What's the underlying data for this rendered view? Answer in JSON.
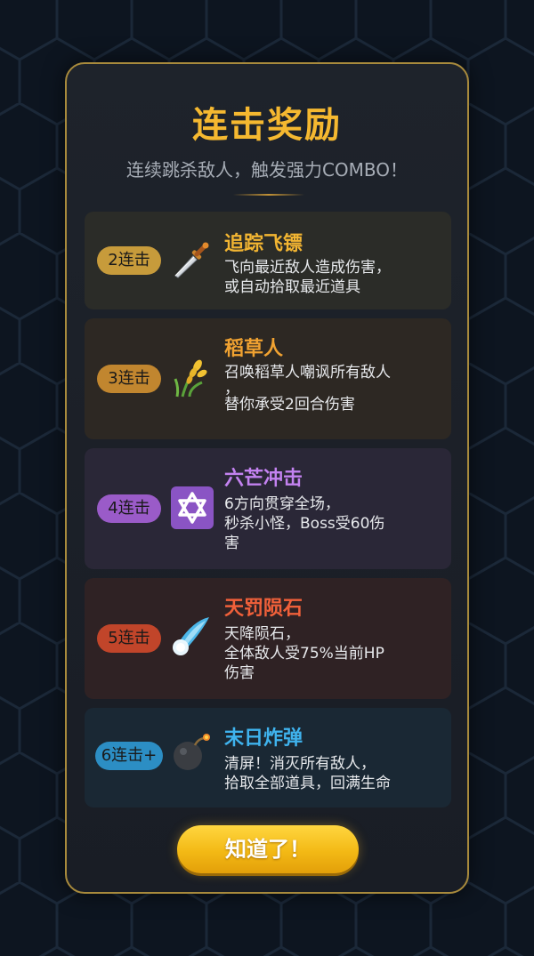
{
  "dialog": {
    "title": "连击奖励",
    "subtitle": "连续跳杀敌人，触发强力COMBO！",
    "ok_label": "知道了！"
  },
  "rewards": [
    {
      "badge": "2连击",
      "icon": "dagger-icon",
      "name": "追踪飞镖",
      "desc": [
        "飞向最近敌人造成伤害，",
        "或自动拾取最近道具"
      ],
      "name_color": "#f2b532",
      "badge_color": "#c79b3b",
      "card_color": "#2b2c28"
    },
    {
      "badge": "3连击",
      "icon": "wheat-icon",
      "name": "稻草人",
      "desc": [
        "召唤稻草人嘲讽所有敌人",
        "，",
        "替你承受2回合伤害"
      ],
      "name_color": "#f0a231",
      "badge_color": "#c1862f",
      "card_color": "#2d2823"
    },
    {
      "badge": "4连击",
      "icon": "star-of-david-icon",
      "name": "六芒冲击",
      "desc": [
        "6方向贯穿全场，",
        "秒杀小怪，Boss受60伤",
        "害"
      ],
      "name_color": "#c382f0",
      "badge_color": "#9a5bc8",
      "card_color": "#2a2737"
    },
    {
      "badge": "5连击",
      "icon": "meteor-icon",
      "name": "天罚陨石",
      "desc": [
        "天降陨石，",
        "全体敌人受75%当前HP",
        "伤害"
      ],
      "name_color": "#f0603a",
      "badge_color": "#c1452a",
      "card_color": "#2f2224"
    },
    {
      "badge": "6连击+",
      "icon": "bomb-icon",
      "name": "末日炸弹",
      "desc": [
        "清屏！消灭所有敌人，",
        "拾取全部道具，回满生命"
      ],
      "name_color": "#3fb3ee",
      "badge_color": "#2c8ec4",
      "card_color": "#1a2834"
    }
  ]
}
